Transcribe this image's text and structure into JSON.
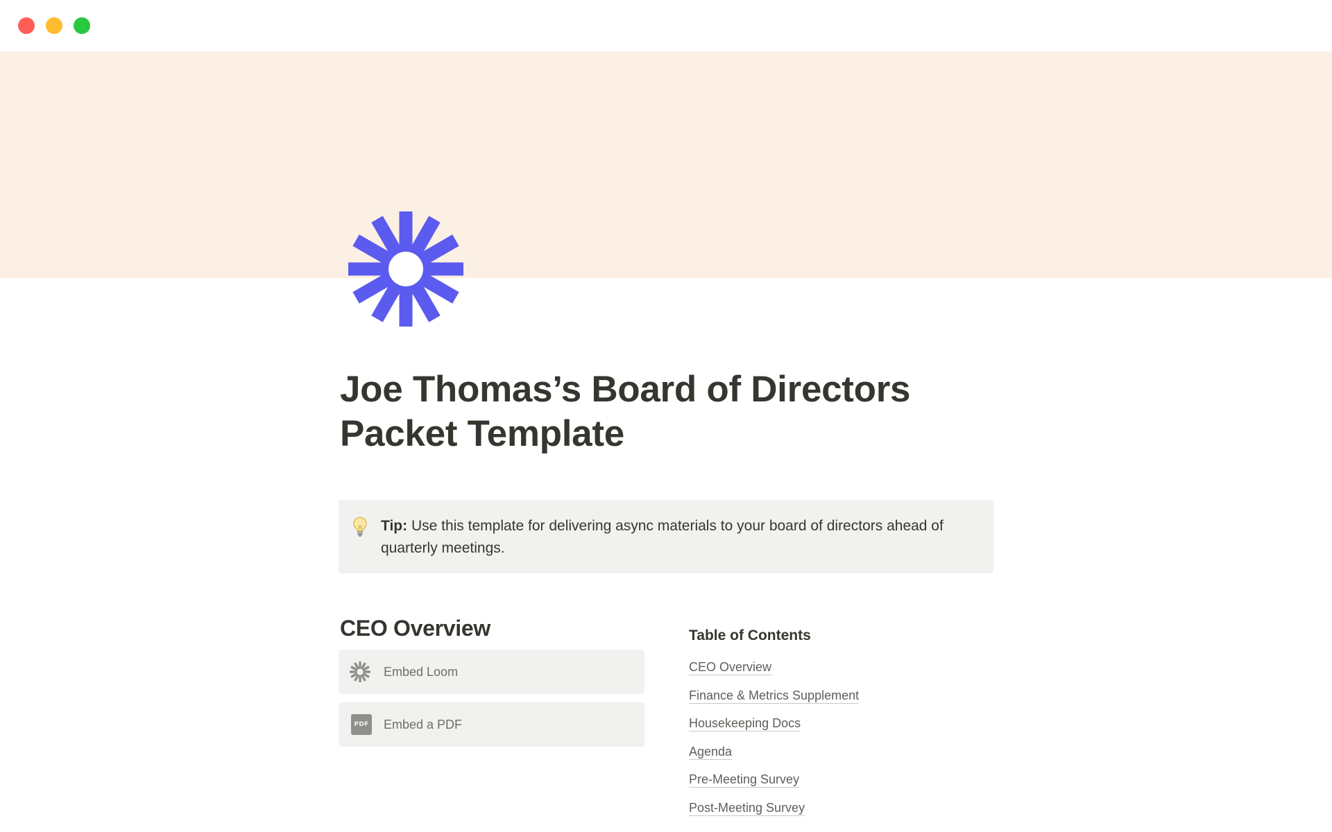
{
  "window": {
    "controls": [
      "close",
      "minimize",
      "zoom"
    ]
  },
  "cover": {
    "color": "#fcf0e4"
  },
  "page": {
    "icon": "loom-asterisk-icon",
    "icon_color": "#5b5bef",
    "title": "Joe Thomas’s Board of Directors Packet Template"
  },
  "callout": {
    "icon": "lightbulb-icon",
    "bold_label": "Tip:",
    "text": " Use this template for delivering async materials to your board of directors ahead of quarterly meetings."
  },
  "ceo_section": {
    "heading": "CEO Overview",
    "embeds": [
      {
        "icon": "loom-icon",
        "label": "Embed Loom"
      },
      {
        "icon": "pdf-icon",
        "icon_text": "PDF",
        "label": "Embed a PDF"
      }
    ]
  },
  "toc": {
    "heading": "Table of Contents",
    "items": [
      "CEO Overview",
      "Finance & Metrics Supplement",
      "Housekeeping Docs",
      "Agenda",
      "Pre-Meeting Survey",
      "Post-Meeting Survey"
    ]
  }
}
